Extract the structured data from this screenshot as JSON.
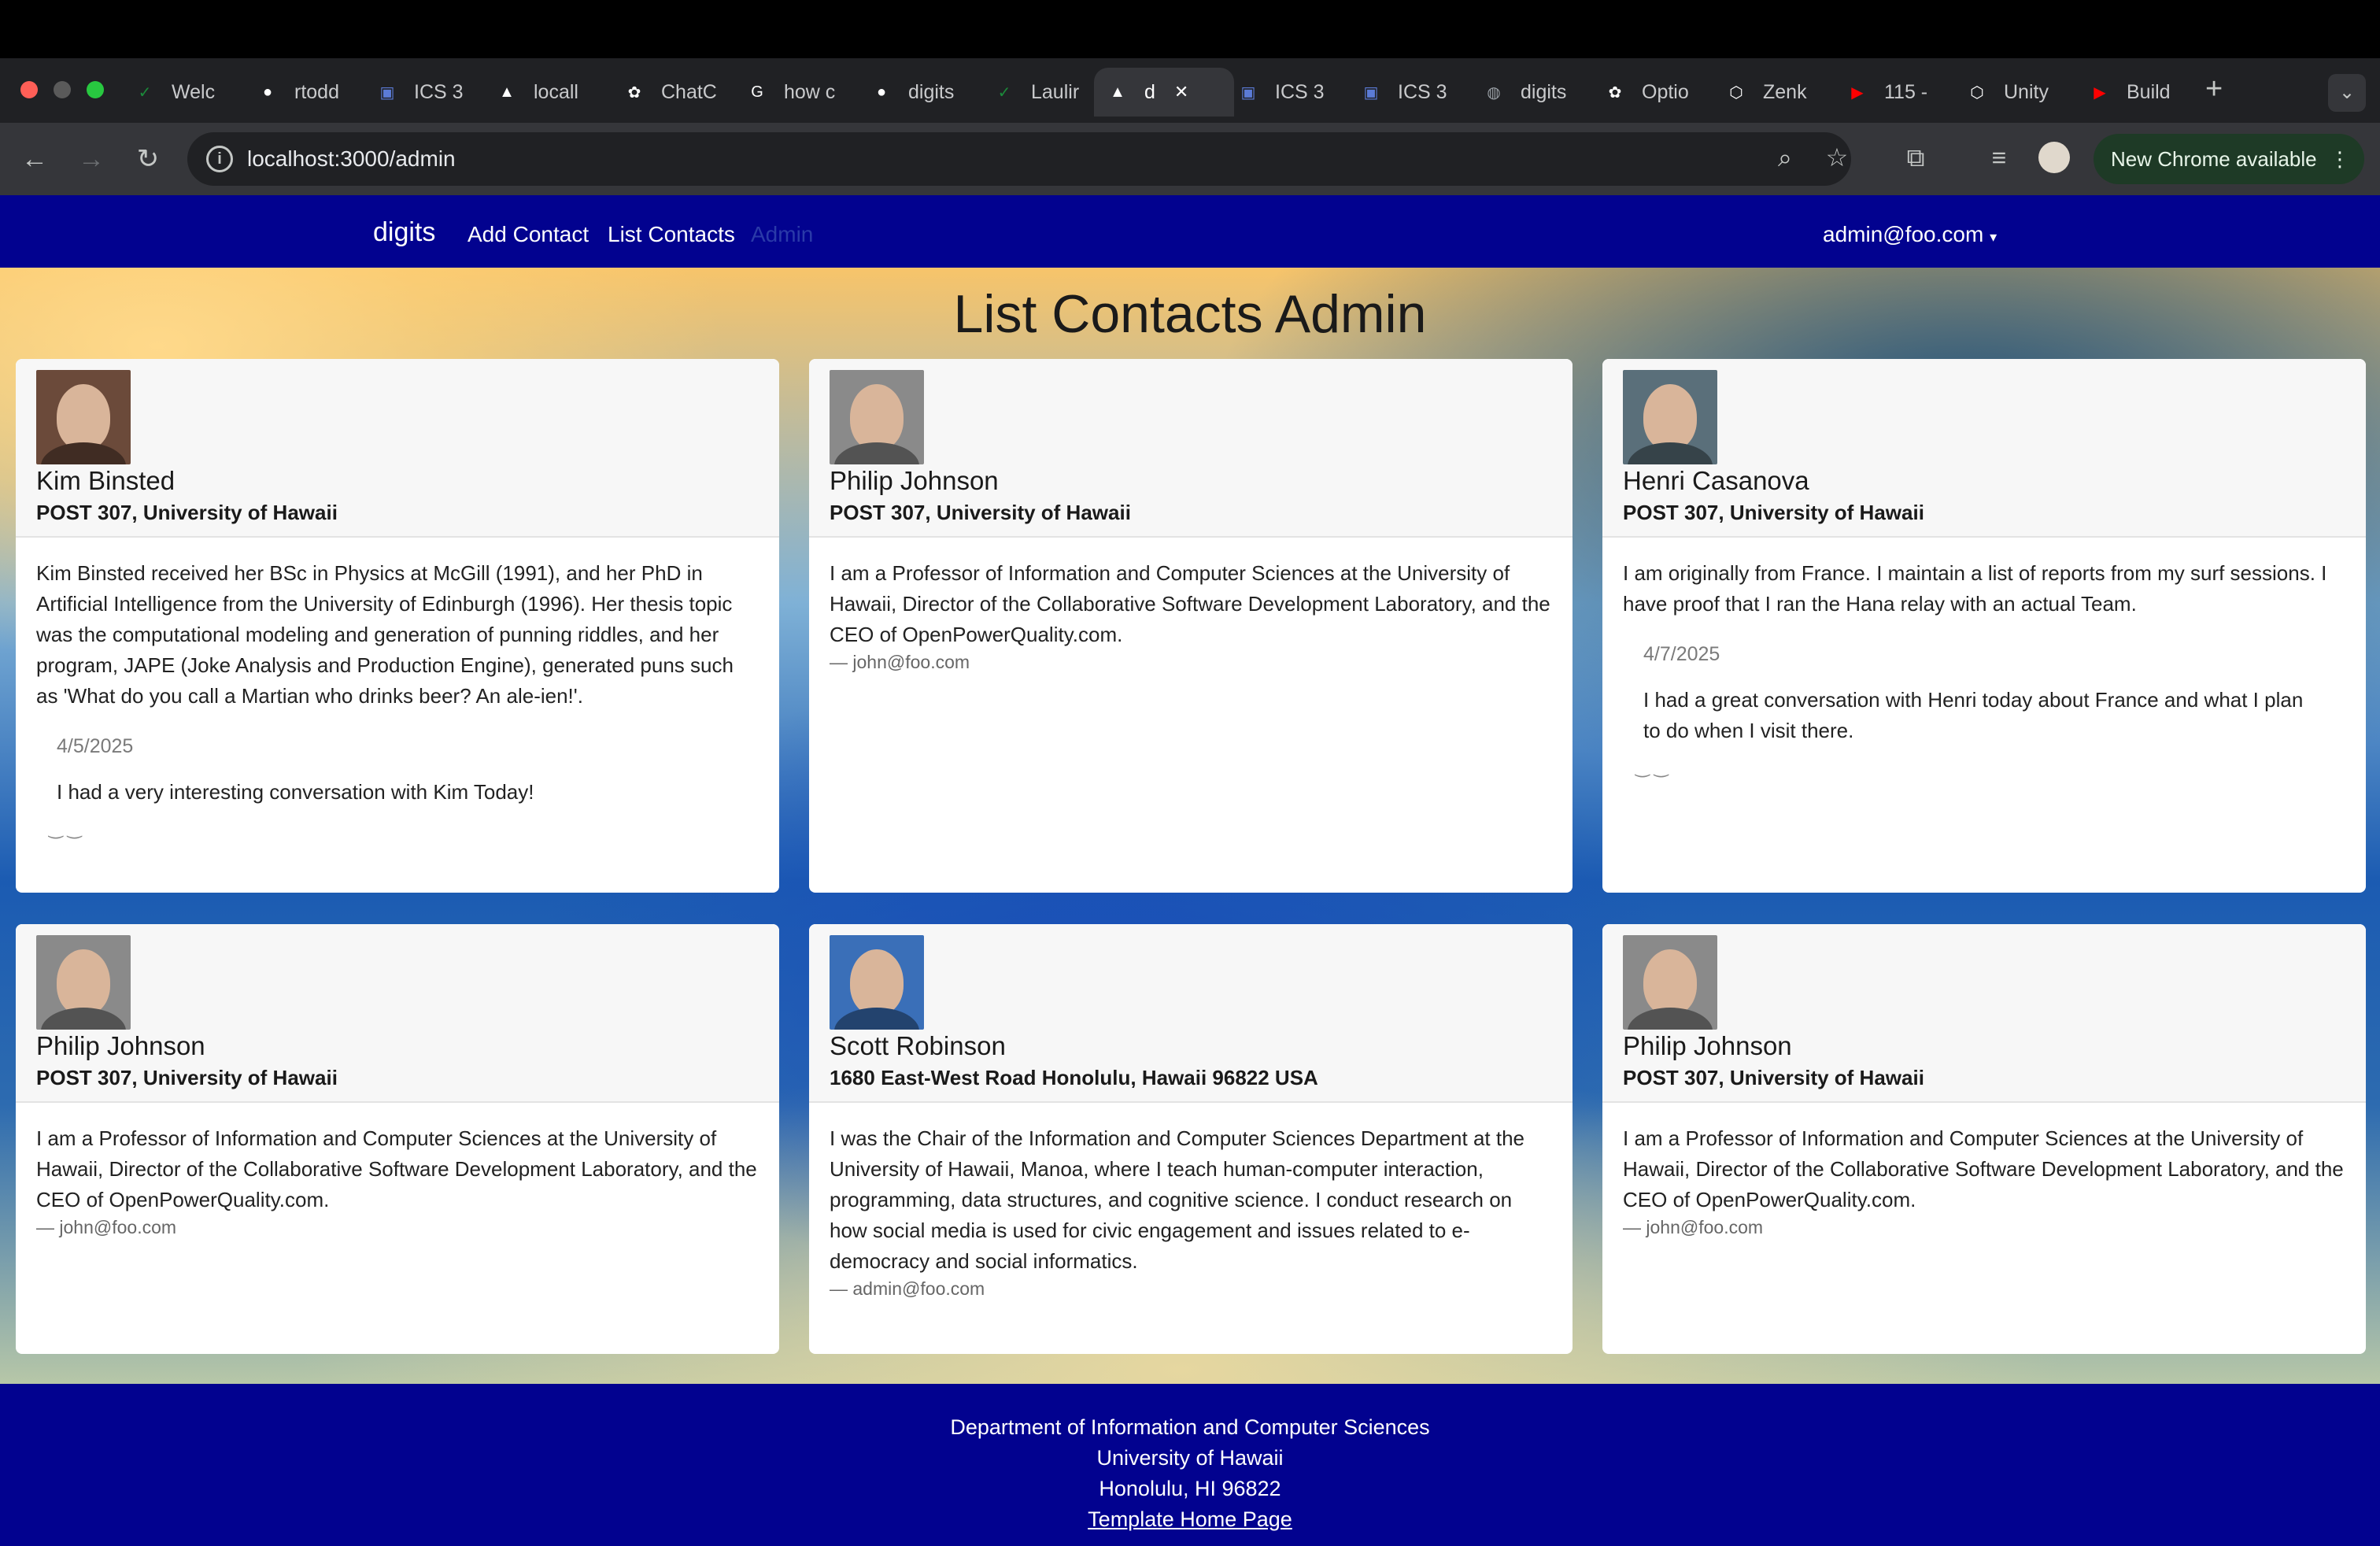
{
  "browser": {
    "tabs": [
      {
        "label": "Welc",
        "icon": "leaf-icon",
        "color": "#1b8a3a"
      },
      {
        "label": "rtodd",
        "icon": "github-icon",
        "color": "#ffffff"
      },
      {
        "label": "ICS 3",
        "icon": "page-icon",
        "color": "#5b7bd6"
      },
      {
        "label": "locall",
        "icon": "triangle-icon",
        "color": "#ffffff"
      },
      {
        "label": "ChatC",
        "icon": "openai-icon",
        "color": "#ffffff"
      },
      {
        "label": "how c",
        "icon": "google-icon",
        "color": "#ffffff"
      },
      {
        "label": "digits",
        "icon": "github-icon",
        "color": "#ffffff"
      },
      {
        "label": "Laulir",
        "icon": "leaf-icon",
        "color": "#1b8a3a"
      },
      {
        "label": "d",
        "icon": "triangle-icon",
        "color": "#ffffff"
      },
      {
        "label": "ICS 3",
        "icon": "page-icon",
        "color": "#5b7bd6"
      },
      {
        "label": "ICS 3",
        "icon": "page-icon",
        "color": "#5b7bd6"
      },
      {
        "label": "digits",
        "icon": "globe-icon",
        "color": "#9aa0a6"
      },
      {
        "label": "Optio",
        "icon": "openai-icon",
        "color": "#ffffff"
      },
      {
        "label": "Zenk",
        "icon": "unity-icon",
        "color": "#ffffff"
      },
      {
        "label": "115 -",
        "icon": "youtube-icon",
        "color": "#ff0000"
      },
      {
        "label": "Unity",
        "icon": "unity-icon",
        "color": "#ffffff"
      },
      {
        "label": "Build",
        "icon": "youtube-icon",
        "color": "#ff0000"
      }
    ],
    "url": "localhost:3000/admin",
    "new_chrome": "New Chrome available"
  },
  "navbar": {
    "brand": "digits",
    "links": [
      "Add Contact",
      "List Contacts",
      "Admin"
    ],
    "user": "admin@foo.com"
  },
  "page_title": "List Contacts Admin",
  "contacts": [
    {
      "name": "Kim Binsted",
      "address": "POST 307, University of Hawaii",
      "description": "Kim Binsted received her BSc in Physics at McGill (1991), and her PhD in Artificial Intelligence from the University of Edinburgh (1996). Her thesis topic was the computational modeling and generation of punning riddles, and her program, JAPE (Joke Analysis and Production Engine), generated puns such as 'What do you call a Martian who drinks beer? An ale-ien!'.",
      "owner": "",
      "note_date": "4/5/2025",
      "note_text": "I had a very interesting conversation with Kim Today!",
      "avatar_color": "#6b4a3a"
    },
    {
      "name": "Philip Johnson",
      "address": "POST 307, University of Hawaii",
      "description": "I am a Professor of Information and Computer Sciences at the University of Hawaii, Director of the Collaborative Software Development Laboratory, and the CEO of OpenPowerQuality.com.",
      "owner": "— john@foo.com",
      "note_date": "",
      "note_text": "",
      "avatar_color": "#8a8a8a"
    },
    {
      "name": "Henri Casanova",
      "address": "POST 307, University of Hawaii",
      "description": "I am originally from France. I maintain a list of reports from my surf sessions. I have proof that I ran the Hana relay with an actual Team.",
      "owner": "",
      "note_date": "4/7/2025",
      "note_text": "I had a great conversation with Henri today about France and what I plan to do when I visit there.",
      "avatar_color": "#5a6f7a"
    },
    {
      "name": "Philip Johnson",
      "address": "POST 307, University of Hawaii",
      "description": "I am a Professor of Information and Computer Sciences at the University of Hawaii, Director of the Collaborative Software Development Laboratory, and the CEO of OpenPowerQuality.com.",
      "owner": "— john@foo.com",
      "note_date": "",
      "note_text": "",
      "avatar_color": "#8a8a8a"
    },
    {
      "name": "Scott Robinson",
      "address": "1680 East-West Road Honolulu, Hawaii 96822 USA",
      "description": "I was the Chair of the Information and Computer Sciences Department at the University of Hawaii, Manoa, where I teach human-computer interaction, programming, data structures, and cognitive science. I conduct research on how social media is used for civic engagement and issues related to e-democracy and social informatics.",
      "owner": "— admin@foo.com",
      "note_date": "",
      "note_text": "",
      "avatar_color": "#3a6fb8"
    },
    {
      "name": "Philip Johnson",
      "address": "POST 307, University of Hawaii",
      "description": "I am a Professor of Information and Computer Sciences at the University of Hawaii, Director of the Collaborative Software Development Laboratory, and the CEO of OpenPowerQuality.com.",
      "owner": "— john@foo.com",
      "note_date": "",
      "note_text": "",
      "avatar_color": "#8a8a8a"
    }
  ],
  "footer": {
    "line1": "Department of Information and Computer Sciences",
    "line2": "University of Hawaii",
    "line3": "Honolulu, HI 96822",
    "link": "Template Home Page"
  }
}
